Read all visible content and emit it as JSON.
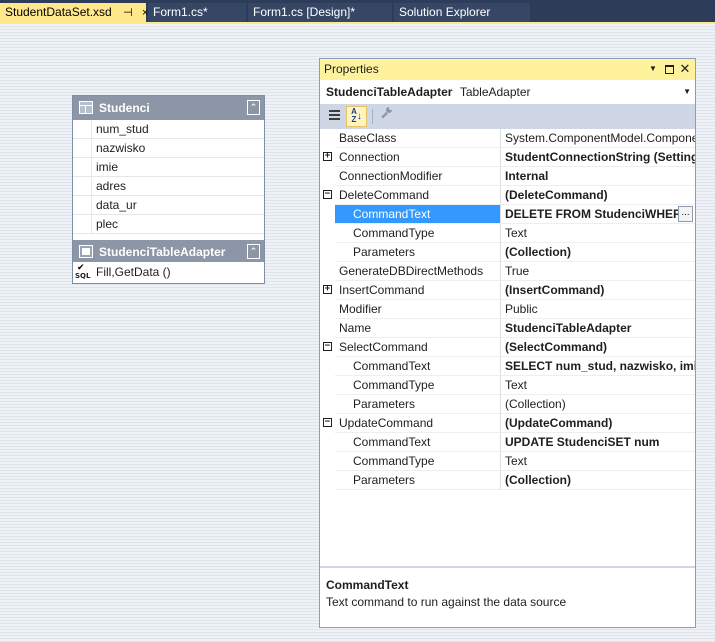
{
  "tabs": [
    {
      "label": "StudentDataSet.xsd",
      "pin": "⊣",
      "close": "×"
    },
    {
      "label": "Form1.cs*"
    },
    {
      "label": "Form1.cs [Design]*"
    },
    {
      "label": "Solution Explorer"
    }
  ],
  "designer": {
    "table_title": "Studenci",
    "columns": [
      "num_stud",
      "nazwisko",
      "imie",
      "adres",
      "data_ur",
      "plec"
    ],
    "adapter_title": "StudenciTableAdapter",
    "adapter_method": "Fill,GetData ()",
    "collapse_glyph": "⌃",
    "sql_label": "SQL",
    "sql_check": "✔"
  },
  "properties": {
    "title": "Properties",
    "dropdown_glyph": "▼",
    "close_glyph": "✕",
    "object_name": "StudenciTableAdapter",
    "object_type": "TableAdapter",
    "rows": [
      {
        "name": "BaseClass",
        "value": "System.ComponentModel.Component",
        "bold": false,
        "expander": "",
        "sub": false
      },
      {
        "name": "Connection",
        "value": "StudentConnectionString (Settings)",
        "bold": true,
        "expander": "+",
        "sub": false
      },
      {
        "name": "ConnectionModifier",
        "value": "Internal",
        "bold": true,
        "expander": "",
        "sub": false
      },
      {
        "name": "DeleteCommand",
        "value": "(DeleteCommand)",
        "bold": true,
        "expander": "−",
        "sub": false
      },
      {
        "name": "CommandText",
        "value": "DELETE FROM StudenciWHERE",
        "bold": true,
        "expander": "",
        "sub": true,
        "selected": true
      },
      {
        "name": "CommandType",
        "value": "Text",
        "bold": false,
        "expander": "",
        "sub": true
      },
      {
        "name": "Parameters",
        "value": "(Collection)",
        "bold": true,
        "expander": "",
        "sub": true
      },
      {
        "name": "GenerateDBDirectMethods",
        "value": "True",
        "bold": false,
        "expander": "",
        "sub": false
      },
      {
        "name": "InsertCommand",
        "value": "(InsertCommand)",
        "bold": true,
        "expander": "+",
        "sub": false
      },
      {
        "name": "Modifier",
        "value": "Public",
        "bold": false,
        "expander": "",
        "sub": false
      },
      {
        "name": "Name",
        "value": "StudenciTableAdapter",
        "bold": true,
        "expander": "",
        "sub": false
      },
      {
        "name": "SelectCommand",
        "value": "(SelectCommand)",
        "bold": true,
        "expander": "−",
        "sub": false
      },
      {
        "name": "CommandText",
        "value": "SELECT        num_stud, nazwisko, imie",
        "bold": true,
        "expander": "",
        "sub": true
      },
      {
        "name": "CommandType",
        "value": "Text",
        "bold": false,
        "expander": "",
        "sub": true
      },
      {
        "name": "Parameters",
        "value": "(Collection)",
        "bold": false,
        "expander": "",
        "sub": true
      },
      {
        "name": "UpdateCommand",
        "value": "(UpdateCommand)",
        "bold": true,
        "expander": "−",
        "sub": false
      },
      {
        "name": "CommandText",
        "value": "UPDATE       StudenciSET            num",
        "bold": true,
        "expander": "",
        "sub": true
      },
      {
        "name": "CommandType",
        "value": "Text",
        "bold": false,
        "expander": "",
        "sub": true
      },
      {
        "name": "Parameters",
        "value": "(Collection)",
        "bold": true,
        "expander": "",
        "sub": true
      }
    ],
    "ellipsis": "...",
    "description_title": "CommandText",
    "description_text": "Text command to run against the data source"
  },
  "colors": {
    "tab_bar": "#2d3c58",
    "active_tab": "#ffe88c",
    "panel_title": "#fff29d",
    "selection": "#3399ff",
    "widget_header": "#8c96a6"
  }
}
